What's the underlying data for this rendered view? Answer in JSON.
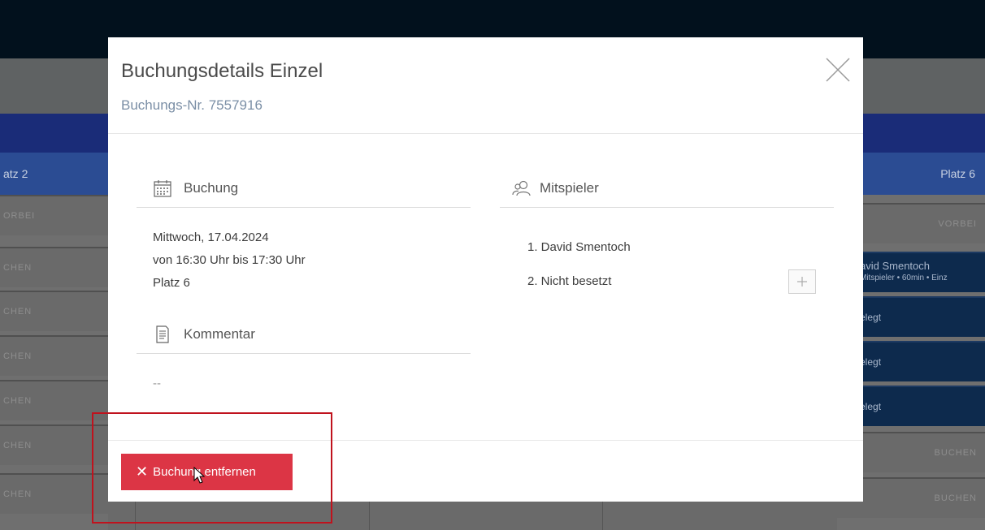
{
  "background": {
    "left_column_header": "atz 2",
    "right_column_header": "Platz 6",
    "left_slots": [
      "ORBEI",
      "CHEN",
      "CHEN",
      "CHEN",
      "CHEN",
      "CHEN",
      "CHEN"
    ],
    "right_slots": {
      "slot1": "VORBEI",
      "slot2_line1": "avid Smentoch",
      "slot2_line2": "Mitspieler • 60min • Einz",
      "slot3": "elegt",
      "slot4": "elegt",
      "slot5": "elegt",
      "slot6": "BUCHEN",
      "slot7": "BUCHEN"
    }
  },
  "modal": {
    "title": "Buchungsdetails Einzel",
    "subtitle": "Buchungs-Nr. 7557916",
    "booking_section": {
      "label": "Buchung",
      "date": "Mittwoch, 17.04.2024",
      "time": "von 16:30 Uhr bis 17:30 Uhr",
      "court": "Platz 6"
    },
    "comment_section": {
      "label": "Kommentar",
      "value": "--"
    },
    "players_section": {
      "label": "Mitspieler",
      "players": [
        "1. David Smentoch",
        "2. Nicht besetzt"
      ]
    },
    "remove_button_label": "Buchung entfernen"
  },
  "colors": {
    "danger": "#dc3545",
    "subtitle": "#7b8fa6",
    "highlight": "#c0121d"
  }
}
